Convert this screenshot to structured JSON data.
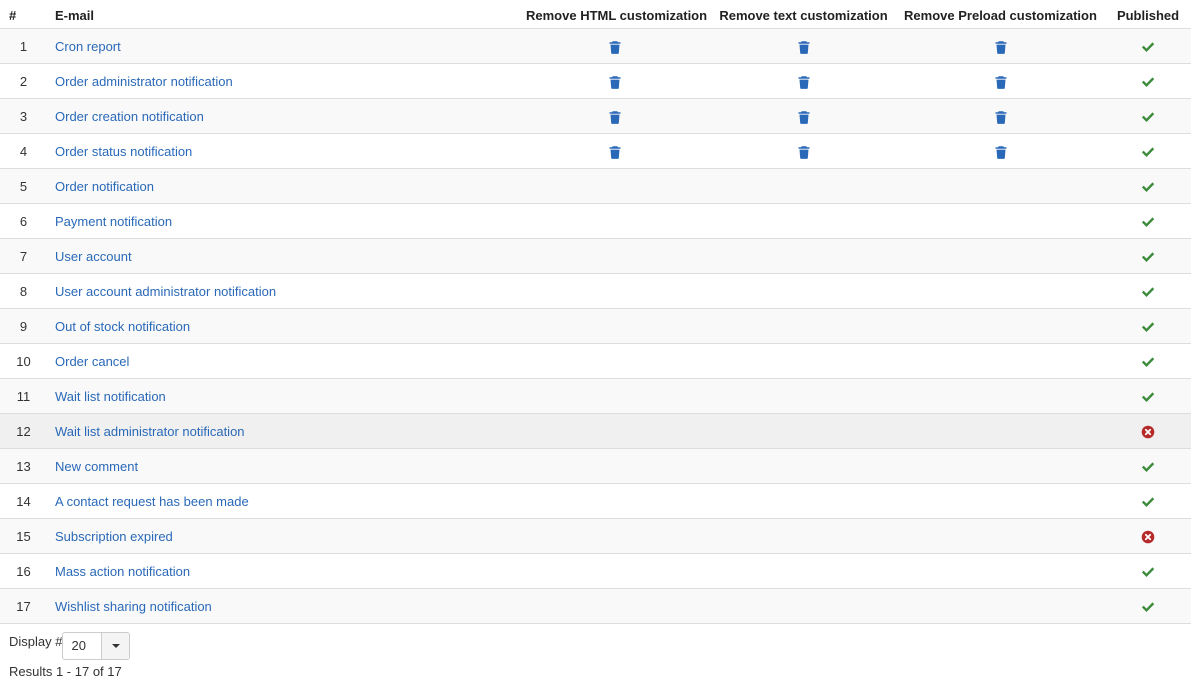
{
  "table": {
    "headers": {
      "num": "#",
      "email": "E-mail",
      "remove_html": "Remove HTML customization",
      "remove_text": "Remove text customization",
      "remove_preload": "Remove Preload customization",
      "published": "Published"
    },
    "rows": [
      {
        "num": "1",
        "name": "Cron report",
        "customized": true,
        "published": true
      },
      {
        "num": "2",
        "name": "Order administrator notification",
        "customized": true,
        "published": true
      },
      {
        "num": "3",
        "name": "Order creation notification",
        "customized": true,
        "published": true
      },
      {
        "num": "4",
        "name": "Order status notification",
        "customized": true,
        "published": true
      },
      {
        "num": "5",
        "name": "Order notification",
        "customized": false,
        "published": true
      },
      {
        "num": "6",
        "name": "Payment notification",
        "customized": false,
        "published": true
      },
      {
        "num": "7",
        "name": "User account",
        "customized": false,
        "published": true
      },
      {
        "num": "8",
        "name": "User account administrator notification",
        "customized": false,
        "published": true
      },
      {
        "num": "9",
        "name": "Out of stock notification",
        "customized": false,
        "published": true
      },
      {
        "num": "10",
        "name": "Order cancel",
        "customized": false,
        "published": true
      },
      {
        "num": "11",
        "name": "Wait list notification",
        "customized": false,
        "published": true
      },
      {
        "num": "12",
        "name": "Wait list administrator notification",
        "customized": false,
        "published": false,
        "hovered": true
      },
      {
        "num": "13",
        "name": "New comment",
        "customized": false,
        "published": true
      },
      {
        "num": "14",
        "name": "A contact request has been made",
        "customized": false,
        "published": true
      },
      {
        "num": "15",
        "name": "Subscription expired",
        "customized": false,
        "published": false
      },
      {
        "num": "16",
        "name": "Mass action notification",
        "customized": false,
        "published": true
      },
      {
        "num": "17",
        "name": "Wishlist sharing notification",
        "customized": false,
        "published": true
      }
    ]
  },
  "icons": {
    "remove": "trash-icon",
    "published": "check-icon",
    "unpublished": "cross-circle-icon"
  },
  "colors": {
    "link": "#2a69b8",
    "trash": "#2a69b8",
    "published": "#3c8b3c",
    "unpublished": "#b52a2a"
  },
  "footer": {
    "display_label": "Display #",
    "display_value": "20",
    "results": "Results 1 - 17 of 17"
  }
}
